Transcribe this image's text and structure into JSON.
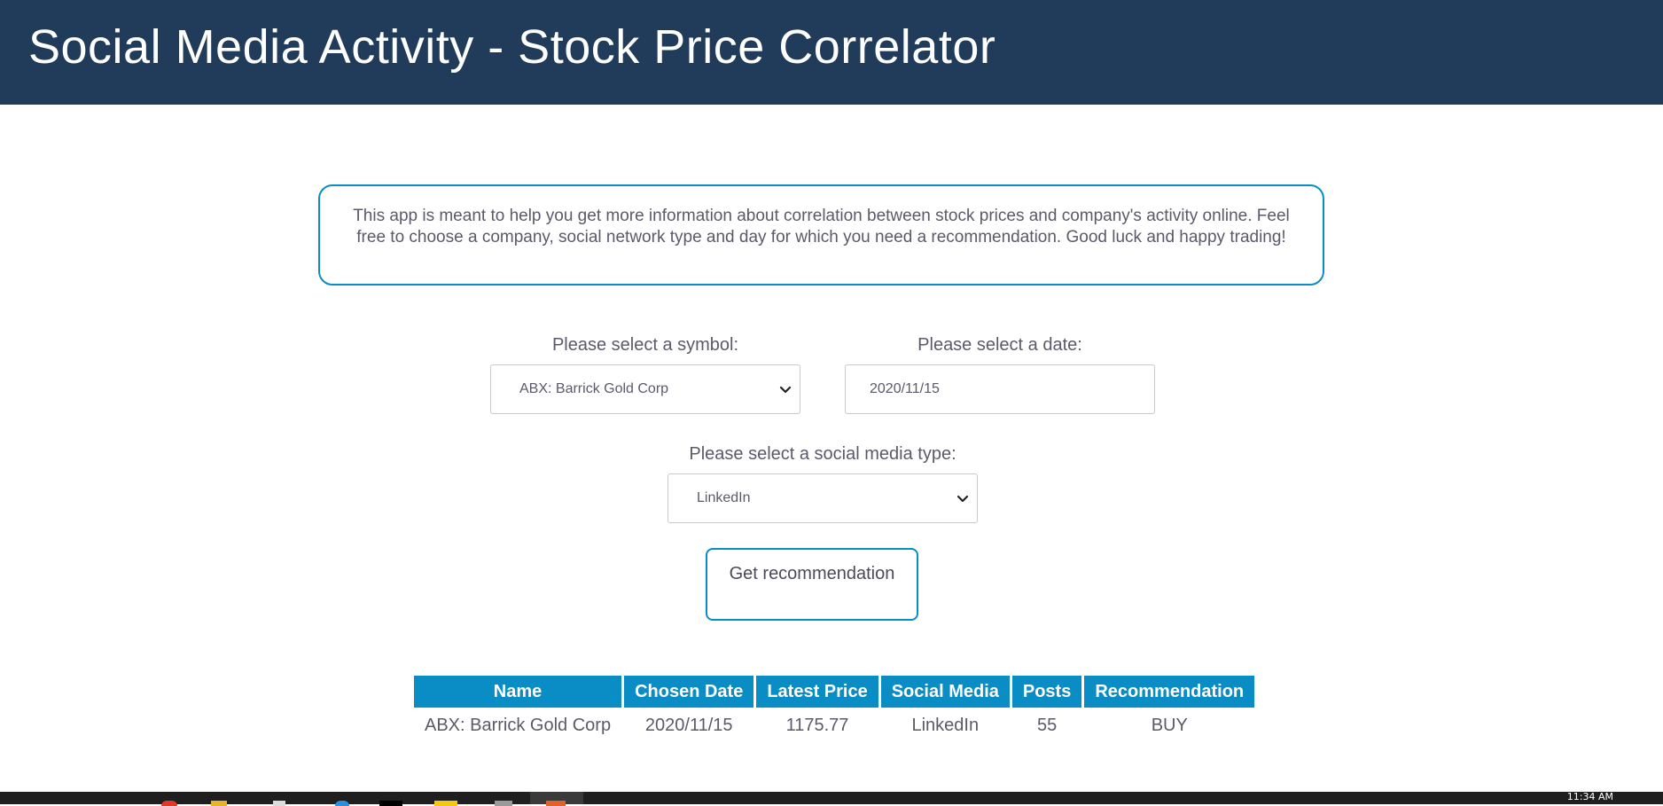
{
  "header": {
    "title": "Social Media Activity - Stock Price Correlator"
  },
  "intro": {
    "text": "This app is meant to help you get more information about correlation between stock prices and company's activity online. Feel free to choose a company, social network type and day for which you need a recommendation. Good luck and happy trading!"
  },
  "form": {
    "symbol_label": "Please select a symbol:",
    "symbol_value": "ABX: Barrick Gold Corp",
    "date_label": "Please select a date:",
    "date_value": "2020/11/15",
    "media_label": "Please select a social media type:",
    "media_value": "LinkedIn",
    "submit_label": "Get recommendation"
  },
  "results": {
    "columns": [
      "Name",
      "Chosen Date",
      "Latest Price",
      "Social Media",
      "Posts",
      "Recommendation"
    ],
    "rows": [
      [
        "ABX: Barrick Gold Corp",
        "2020/11/15",
        "1175.77",
        "LinkedIn",
        "55",
        "BUY"
      ]
    ]
  },
  "taskbar": {
    "clock": "11:34 AM"
  },
  "colors": {
    "header_bg": "#213c5a",
    "accent": "#0a8cc4"
  }
}
